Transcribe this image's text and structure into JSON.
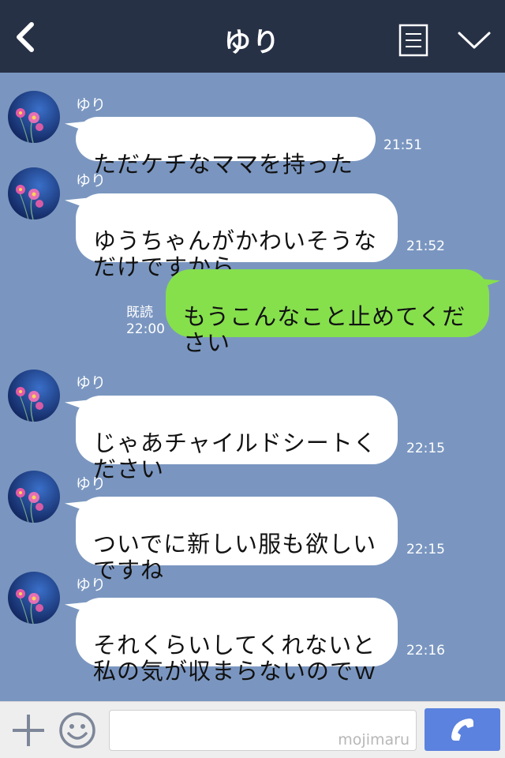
{
  "header": {
    "title": "ゆり",
    "back_icon": "chevron-left-icon",
    "menu_icon": "list-icon",
    "expand_icon": "chevron-down-icon"
  },
  "messages": [
    {
      "sender": "ゆり",
      "text": "ただケチなママを持った",
      "time": "21:51",
      "direction": "in"
    },
    {
      "sender": "ゆり",
      "text": "ゆうちゃんがかわいそうな\nだけですから",
      "time": "21:52",
      "direction": "in"
    },
    {
      "text": "もうこんなこと止めてくだ\nさい",
      "read_label": "既読",
      "time": "22:00",
      "direction": "out"
    },
    {
      "sender": "ゆり",
      "text": "じゃあチャイルドシートく\nださい",
      "time": "22:15",
      "direction": "in"
    },
    {
      "sender": "ゆり",
      "text": "ついでに新しい服も欲しい\nですね",
      "time": "22:15",
      "direction": "in"
    },
    {
      "sender": "ゆり",
      "text": "それくらいしてくれないと\n私の気が収まらないのでｗ",
      "time": "22:16",
      "direction": "in"
    }
  ],
  "footer": {
    "plus_icon": "plus-icon",
    "emoji_icon": "smiley-icon",
    "input_value": "",
    "watermark": "mojimaru",
    "call_icon": "phone-icon"
  },
  "colors": {
    "header_bg": "#273146",
    "chat_bg": "#7a96c0",
    "incoming_bubble": "#ffffff",
    "outgoing_bubble": "#86e04c",
    "call_button": "#5b82de"
  }
}
